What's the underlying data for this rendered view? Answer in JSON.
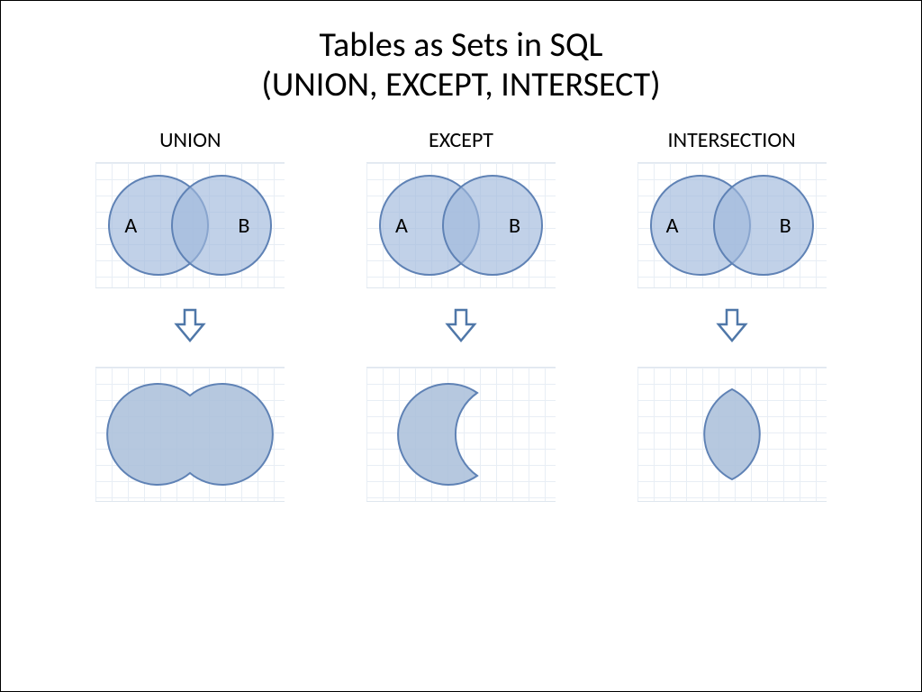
{
  "title": {
    "line1": "Tables as Sets in SQL",
    "line2": "(UNION, EXCEPT, INTERSECT)"
  },
  "columns": [
    {
      "label": "UNION",
      "a": "A",
      "b": "B",
      "result_shape": "union"
    },
    {
      "label": "EXCEPT",
      "a": "A",
      "b": "B",
      "result_shape": "except"
    },
    {
      "label": "INTERSECTION",
      "a": "A",
      "b": "B",
      "result_shape": "intersection"
    }
  ],
  "icons": {
    "down_arrow": "down-arrow-icon"
  },
  "colors": {
    "circle_fill": "#a9bed9",
    "circle_stroke": "#5f82b5",
    "grid_line": "#e8eef5"
  }
}
